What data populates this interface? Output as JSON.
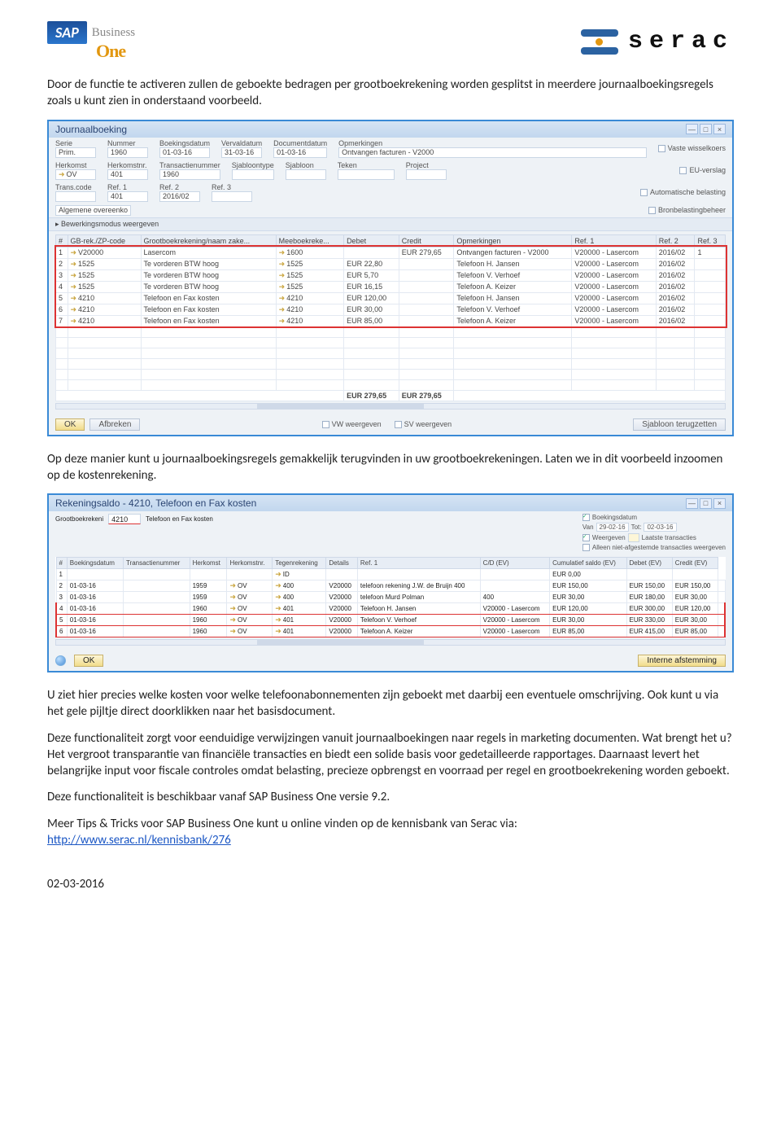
{
  "header": {
    "sap_text": "SAP",
    "sap_sub1": "Business",
    "sap_sub2": "One",
    "serac_text": "serac"
  },
  "p1": "Door de functie te activeren zullen de geboekte bedragen per grootboekrekening worden gesplitst in meerdere journaalboekingsregels zoals u kunt zien in onderstaand voorbeeld.",
  "p2": "Op deze manier kunt u journaalboekingsregels gemakkelijk terugvinden in uw grootboekrekeningen. Laten we in dit voorbeeld inzoomen op de kostenrekening.",
  "p3": "U ziet hier precies welke kosten voor welke telefoonabonnementen zijn geboekt met daarbij een eventuele omschrijving. Ook kunt u via het gele pijltje direct doorklikken naar het basisdocument.",
  "p4": "Deze functionaliteit zorgt voor eenduidige verwijzingen vanuit journaalboekingen naar regels in marketing documenten. Wat brengt het u? Het vergroot transparantie van financiële transacties en biedt een solide basis voor gedetailleerde rapportages. Daarnaast levert het belangrijke input voor fiscale controles omdat belasting, precieze opbrengst en voorraad per regel en grootboekrekening worden geboekt.",
  "p5": "Deze functionaliteit is beschikbaar vanaf SAP Business One versie 9.2.",
  "p6a": "Meer Tips & Tricks voor SAP Business One kunt u online vinden op de kennisbank van Serac via:",
  "p6_link": "http://www.serac.nl/kennisbank/276",
  "date": "02-03-2016",
  "win1": {
    "title": "Journaalboeking",
    "labels": {
      "serie": "Serie",
      "nummer": "Nummer",
      "boekingsdatum": "Boekingsdatum",
      "vervaldatum": "Vervaldatum",
      "documentdatum": "Documentdatum",
      "opmerkingen": "Opmerkingen",
      "herkomst": "Herkomst",
      "herkomstnr": "Herkomstnr.",
      "transactienummer": "Transactienummer",
      "sjabloontype": "Sjabloontype",
      "sjabloon": "Sjabloon",
      "teken": "Teken",
      "project": "Project",
      "transcode": "Trans.code",
      "ref1": "Ref. 1",
      "ref2": "Ref. 2",
      "ref3": "Ref. 3"
    },
    "vals": {
      "serie": "Prim.",
      "nummer": "1960",
      "boekingsdatum": "01-03-16",
      "vervaldatum": "31-03-16",
      "documentdatum": "01-03-16",
      "opmerkingen": "Ontvangen facturen - V2000",
      "herkomst": "OV",
      "herkomstnr": "401",
      "transactienummer": "1960",
      "sjabloontype": "",
      "sjabloon": "",
      "teken": "",
      "project": "",
      "transcode": "",
      "ref1": "401",
      "ref2": "2016/02",
      "ref3": ""
    },
    "chks": {
      "vaste": "Vaste wisselkoers",
      "eu": "EU-verslag",
      "auto": "Automatische belasting",
      "bron": "Bronbelastingbeheer"
    },
    "alg": "Algemene overeenko",
    "bewerk": "Bewerkingsmodus weergeven",
    "cols": [
      "#",
      "GB-rek./ZP-code",
      "Grootboekrekening/naam zake...",
      "Meeboekreke...",
      "Debet",
      "Credit",
      "Opmerkingen",
      "Ref. 1",
      "Ref. 2",
      "Ref. 3"
    ],
    "rows": [
      [
        "1",
        "V20000",
        "Lasercom",
        "1600",
        "",
        "EUR 279,65",
        "Ontvangen facturen - V2000",
        "V20000 - Lasercom",
        "2016/02",
        "1"
      ],
      [
        "2",
        "1525",
        "Te vorderen BTW hoog",
        "1525",
        "EUR 22,80",
        "",
        "Telefoon H. Jansen",
        "V20000 - Lasercom",
        "2016/02",
        ""
      ],
      [
        "3",
        "1525",
        "Te vorderen BTW hoog",
        "1525",
        "EUR 5,70",
        "",
        "Telefoon V. Verhoef",
        "V20000 - Lasercom",
        "2016/02",
        ""
      ],
      [
        "4",
        "1525",
        "Te vorderen BTW hoog",
        "1525",
        "EUR 16,15",
        "",
        "Telefoon A. Keizer",
        "V20000 - Lasercom",
        "2016/02",
        ""
      ],
      [
        "5",
        "4210",
        "Telefoon en Fax kosten",
        "4210",
        "EUR 120,00",
        "",
        "Telefoon H. Jansen",
        "V20000 - Lasercom",
        "2016/02",
        ""
      ],
      [
        "6",
        "4210",
        "Telefoon en Fax kosten",
        "4210",
        "EUR 30,00",
        "",
        "Telefoon V. Verhoef",
        "V20000 - Lasercom",
        "2016/02",
        ""
      ],
      [
        "7",
        "4210",
        "Telefoon en Fax kosten",
        "4210",
        "EUR 85,00",
        "",
        "Telefoon A. Keizer",
        "V20000 - Lasercom",
        "2016/02",
        ""
      ]
    ],
    "totals": {
      "debet": "EUR 279,65",
      "credit": "EUR 279,65"
    },
    "btns": {
      "ok": "OK",
      "afbreken": "Afbreken",
      "vw": "VW weergeven",
      "sv": "SV weergeven",
      "sjabloon": "Sjabloon terugzetten"
    }
  },
  "win2": {
    "title": "Rekeningsaldo - 4210, Telefoon en Fax kosten",
    "gbk_label": "Grootboekrekeni",
    "gbk_val": "4210",
    "gbk_name": "Telefoon en Fax kosten",
    "chks": {
      "boek": "Boekingsdatum",
      "van": "Van",
      "van_v": "29-02-16",
      "tot": "Tot:",
      "tot_v": "02-03-16",
      "weerg": "Weergeven",
      "laatste": "Laatste transacties",
      "alleen": "Alleen niet-afgestemde transacties weergeven"
    },
    "cols": [
      "#",
      "Boekingsdatum",
      "Transactienummer",
      "Herkomst",
      "Herkomstnr.",
      "Tegenrekening",
      "Details",
      "Ref. 1",
      "C/D (EV)",
      "Cumulatief saldo (EV)",
      "Debet (EV)",
      "Credit (EV)"
    ],
    "rows": [
      [
        "1",
        "",
        "",
        "",
        "",
        "ID",
        "",
        "",
        "",
        "EUR 0,00",
        "",
        ""
      ],
      [
        "2",
        "01-03-16",
        "",
        "1959",
        "OV",
        "400",
        "V20000",
        "telefoon rekening J.W. de Bruijn  400",
        "",
        "EUR 150,00",
        "EUR 150,00",
        "EUR 150,00",
        ""
      ],
      [
        "3",
        "01-03-16",
        "",
        "1959",
        "OV",
        "400",
        "V20000",
        "telefoon Murd Polman",
        "400",
        "EUR 30,00",
        "EUR 180,00",
        "EUR 30,00",
        ""
      ],
      [
        "4",
        "01-03-16",
        "",
        "1960",
        "OV",
        "401",
        "V20000",
        "Telefoon H. Jansen",
        "V20000 - Lasercom",
        "EUR 120,00",
        "EUR 300,00",
        "EUR 120,00",
        ""
      ],
      [
        "5",
        "01-03-16",
        "",
        "1960",
        "OV",
        "401",
        "V20000",
        "Telefoon V. Verhoef",
        "V20000 - Lasercom",
        "EUR 30,00",
        "EUR 330,00",
        "EUR 30,00",
        ""
      ],
      [
        "6",
        "01-03-16",
        "",
        "1960",
        "OV",
        "401",
        "V20000",
        "Telefoon A. Keizer",
        "V20000 - Lasercom",
        "EUR 85,00",
        "EUR 415,00",
        "EUR 85,00",
        ""
      ]
    ],
    "btns": {
      "ok": "OK",
      "intern": "Interne afstemming"
    }
  }
}
